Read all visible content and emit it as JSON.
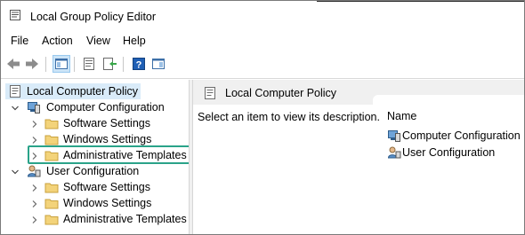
{
  "window": {
    "title": "Local Group Policy Editor"
  },
  "menu": [
    "File",
    "Action",
    "View",
    "Help"
  ],
  "toolbar": {
    "buttons": [
      "back-arrow-icon",
      "forward-arrow-icon",
      "show-hide-tree-icon",
      "properties-icon",
      "export-list-icon",
      "help-icon",
      "show-hide-action-pane-icon"
    ]
  },
  "tree": {
    "root": "Local Computer Policy",
    "computer": {
      "label": "Computer Configuration",
      "children": [
        "Software Settings",
        "Windows Settings",
        "Administrative Templates"
      ]
    },
    "user": {
      "label": "User Configuration",
      "children": [
        "Software Settings",
        "Windows Settings",
        "Administrative Templates"
      ]
    },
    "highlighted": "Administrative Templates"
  },
  "right_pane": {
    "header": "Local Computer Policy",
    "description": "Select an item to view its description.",
    "column_name": "Name",
    "items": [
      "Computer Configuration",
      "User Configuration"
    ]
  },
  "colors": {
    "highlight_border": "#2aa389",
    "selection": "#d9ebf9",
    "folder": "#f3d37a"
  }
}
